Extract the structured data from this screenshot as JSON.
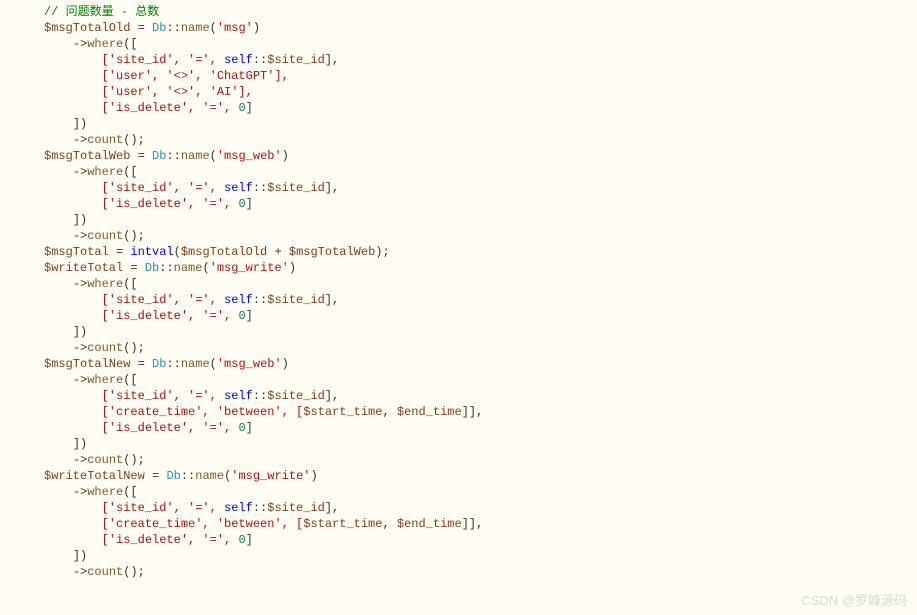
{
  "code": {
    "l1": "// 问题数量 - 总数",
    "l2_var": "$msgTotalOld",
    "l2_eq": " = ",
    "l2_cls": "Db",
    "l2_dcolon": "::",
    "l2_name": "name",
    "l2_lp": "(",
    "l2_str": "'msg'",
    "l2_rp": ")",
    "where": "where",
    "lp_arr": "([",
    "rp_arr": "])",
    "arrow": "->",
    "siteid_open": "['site_id', '=', ",
    "self": "self",
    "dcolon": "::",
    "siteid": "$site_id",
    "close_br": "],",
    "user_chatgpt": "['user', '<>', 'ChatGPT'],",
    "user_ai": "['user', '<>', 'AI'],",
    "isdel_open": "['is_delete', '=', ",
    "zero": "0",
    "close_last": "]",
    "count": "count",
    "empty_call": "();",
    "l7_var": "$msgTotalWeb",
    "l7_str": "'msg_web'",
    "l12_var": "$msgTotal",
    "l12_eq": " = ",
    "intval": "intval",
    "l12_lp": "(",
    "l12_a": "$msgTotalOld",
    "l12_plus": " + ",
    "l12_b": "$msgTotalWeb",
    "l12_rp": ");",
    "l13_var": "$writeTotal",
    "l13_str": "'msg_write'",
    "l18_var": "$msgTotalNew",
    "create_open": "['create_time', 'between', [",
    "start_time": "$start_time",
    "comma_sp": ", ",
    "end_time": "$end_time",
    "create_close": "]],",
    "l25_var": "$writeTotalNew"
  },
  "watermark": "CSDN @罗峰源码"
}
